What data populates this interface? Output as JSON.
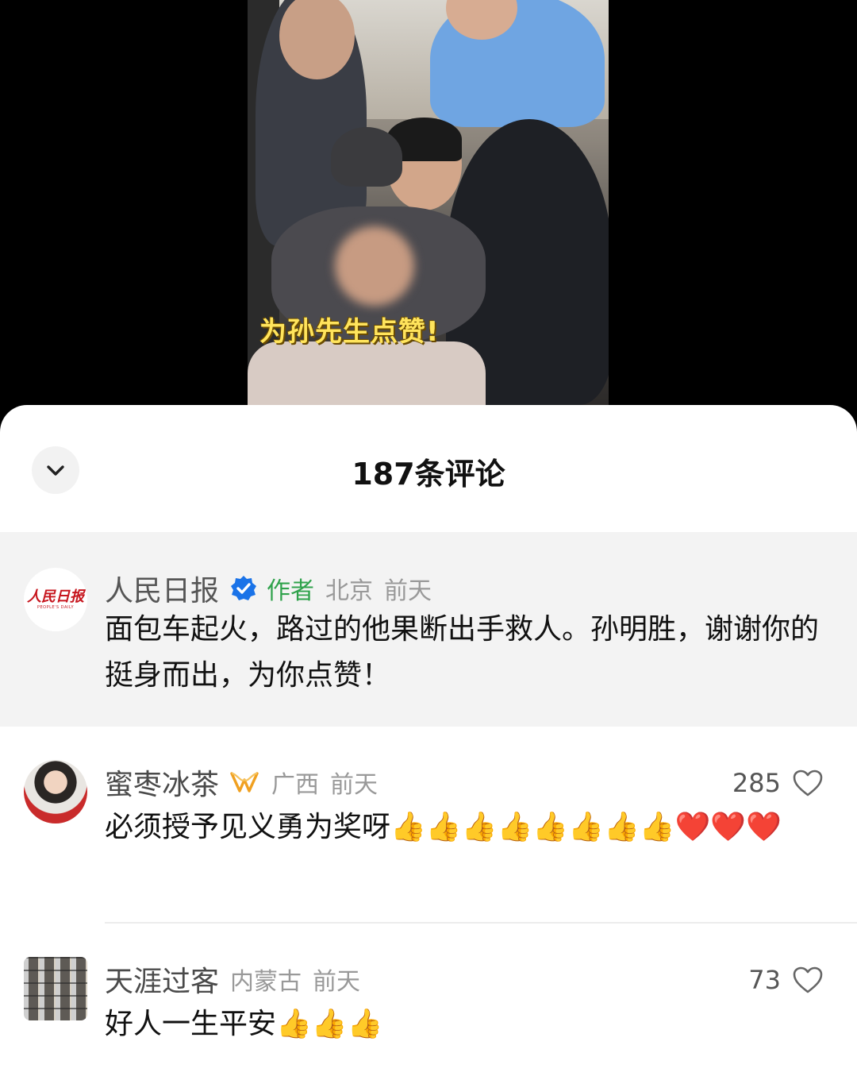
{
  "video": {
    "caption": "为孙先生点赞!"
  },
  "sheet": {
    "title": "187条评论"
  },
  "pinned_comment": {
    "avatar_logo": "人民日报",
    "avatar_logo_sub": "PEOPLE'S DAILY",
    "author": "人民日报",
    "author_tag": "作者",
    "location": "北京",
    "time": "前天",
    "text": "面包车起火，路过的他果断出手救人。孙明胜，谢谢你的挺身而出，为你点赞！"
  },
  "comments": [
    {
      "author": "蜜枣冰茶",
      "location": "广西",
      "time": "前天",
      "text": "必须授予见义勇为奖呀👍👍👍👍👍👍👍👍❤️❤️❤️",
      "likes": "285"
    },
    {
      "author": "天涯过客",
      "location": "内蒙古",
      "time": "前天",
      "text": "好人一生平安👍👍👍",
      "likes": "73"
    }
  ],
  "icons": {
    "collapse": "chevron-down-icon",
    "verified": "verified-badge-icon",
    "vip": "vip-badge-icon",
    "like": "heart-outline-icon"
  },
  "colors": {
    "author_tag": "#2fa24b",
    "verified": "#1a73e8",
    "vip": "#f0a020",
    "pinned_bg": "#f3f3f3"
  }
}
